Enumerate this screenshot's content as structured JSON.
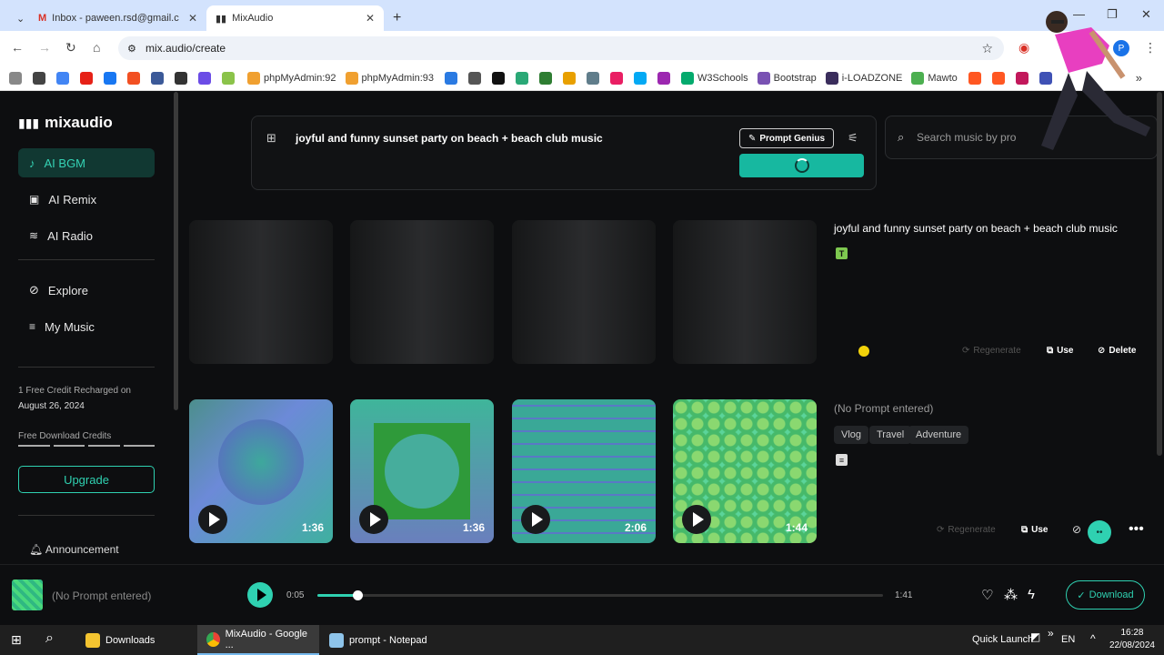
{
  "browser": {
    "tabs": [
      {
        "label": "Inbox - paween.rsd@gmail.com",
        "active": false
      },
      {
        "label": "MixAudio",
        "active": true
      }
    ],
    "url": "mix.audio/create",
    "profile_initial": "P",
    "bookmarks": [
      "phpMyAdmin:92",
      "phpMyAdmin:93",
      "W3Schools",
      "Bootstrap",
      "i-LOADZONE",
      "Mawto"
    ]
  },
  "sidebar": {
    "brand": "mixaudio",
    "items": [
      {
        "label": "AI BGM",
        "active": true
      },
      {
        "label": "AI Remix",
        "active": false
      },
      {
        "label": "AI Radio",
        "active": false
      },
      {
        "label": "Explore",
        "active": false
      },
      {
        "label": "My Music",
        "active": false
      }
    ],
    "credit_line1": "1 Free Credit Recharged on",
    "credit_line2": "August 26, 2024",
    "free_download": "Free Download Credits",
    "upgrade": "Upgrade",
    "announcement": "Announcement"
  },
  "prompt": {
    "text": "joyful and funny sunset party on beach + beach club music",
    "genius": "Prompt Genius"
  },
  "search": {
    "placeholder": "Search music by pro"
  },
  "rows": [
    {
      "title": "joyful and funny sunset party on beach + beach club music",
      "badge": "T",
      "actions": {
        "regenerate": "Regenerate",
        "use": "Use",
        "delete": "Delete"
      }
    },
    {
      "title": "(No Prompt entered)",
      "tags": [
        "Vlog",
        "Travel",
        "Adventure"
      ],
      "durations": [
        "1:36",
        "1:36",
        "2:06",
        "1:44"
      ],
      "actions": {
        "regenerate": "Regenerate",
        "use": "Use"
      }
    }
  ],
  "player": {
    "title": "(No Prompt entered)",
    "current": "0:05",
    "total": "1:41",
    "progress": 0.07,
    "download": "Download"
  },
  "taskbar": {
    "items": [
      "Downloads",
      "MixAudio - Google ...",
      "prompt - Notepad"
    ],
    "quick_launch": "Quick Launch",
    "lang": "EN",
    "time": "16:28",
    "date": "22/08/2024"
  },
  "colors": {
    "accent": "#2fd1b1",
    "bg": "#0d0e10"
  }
}
